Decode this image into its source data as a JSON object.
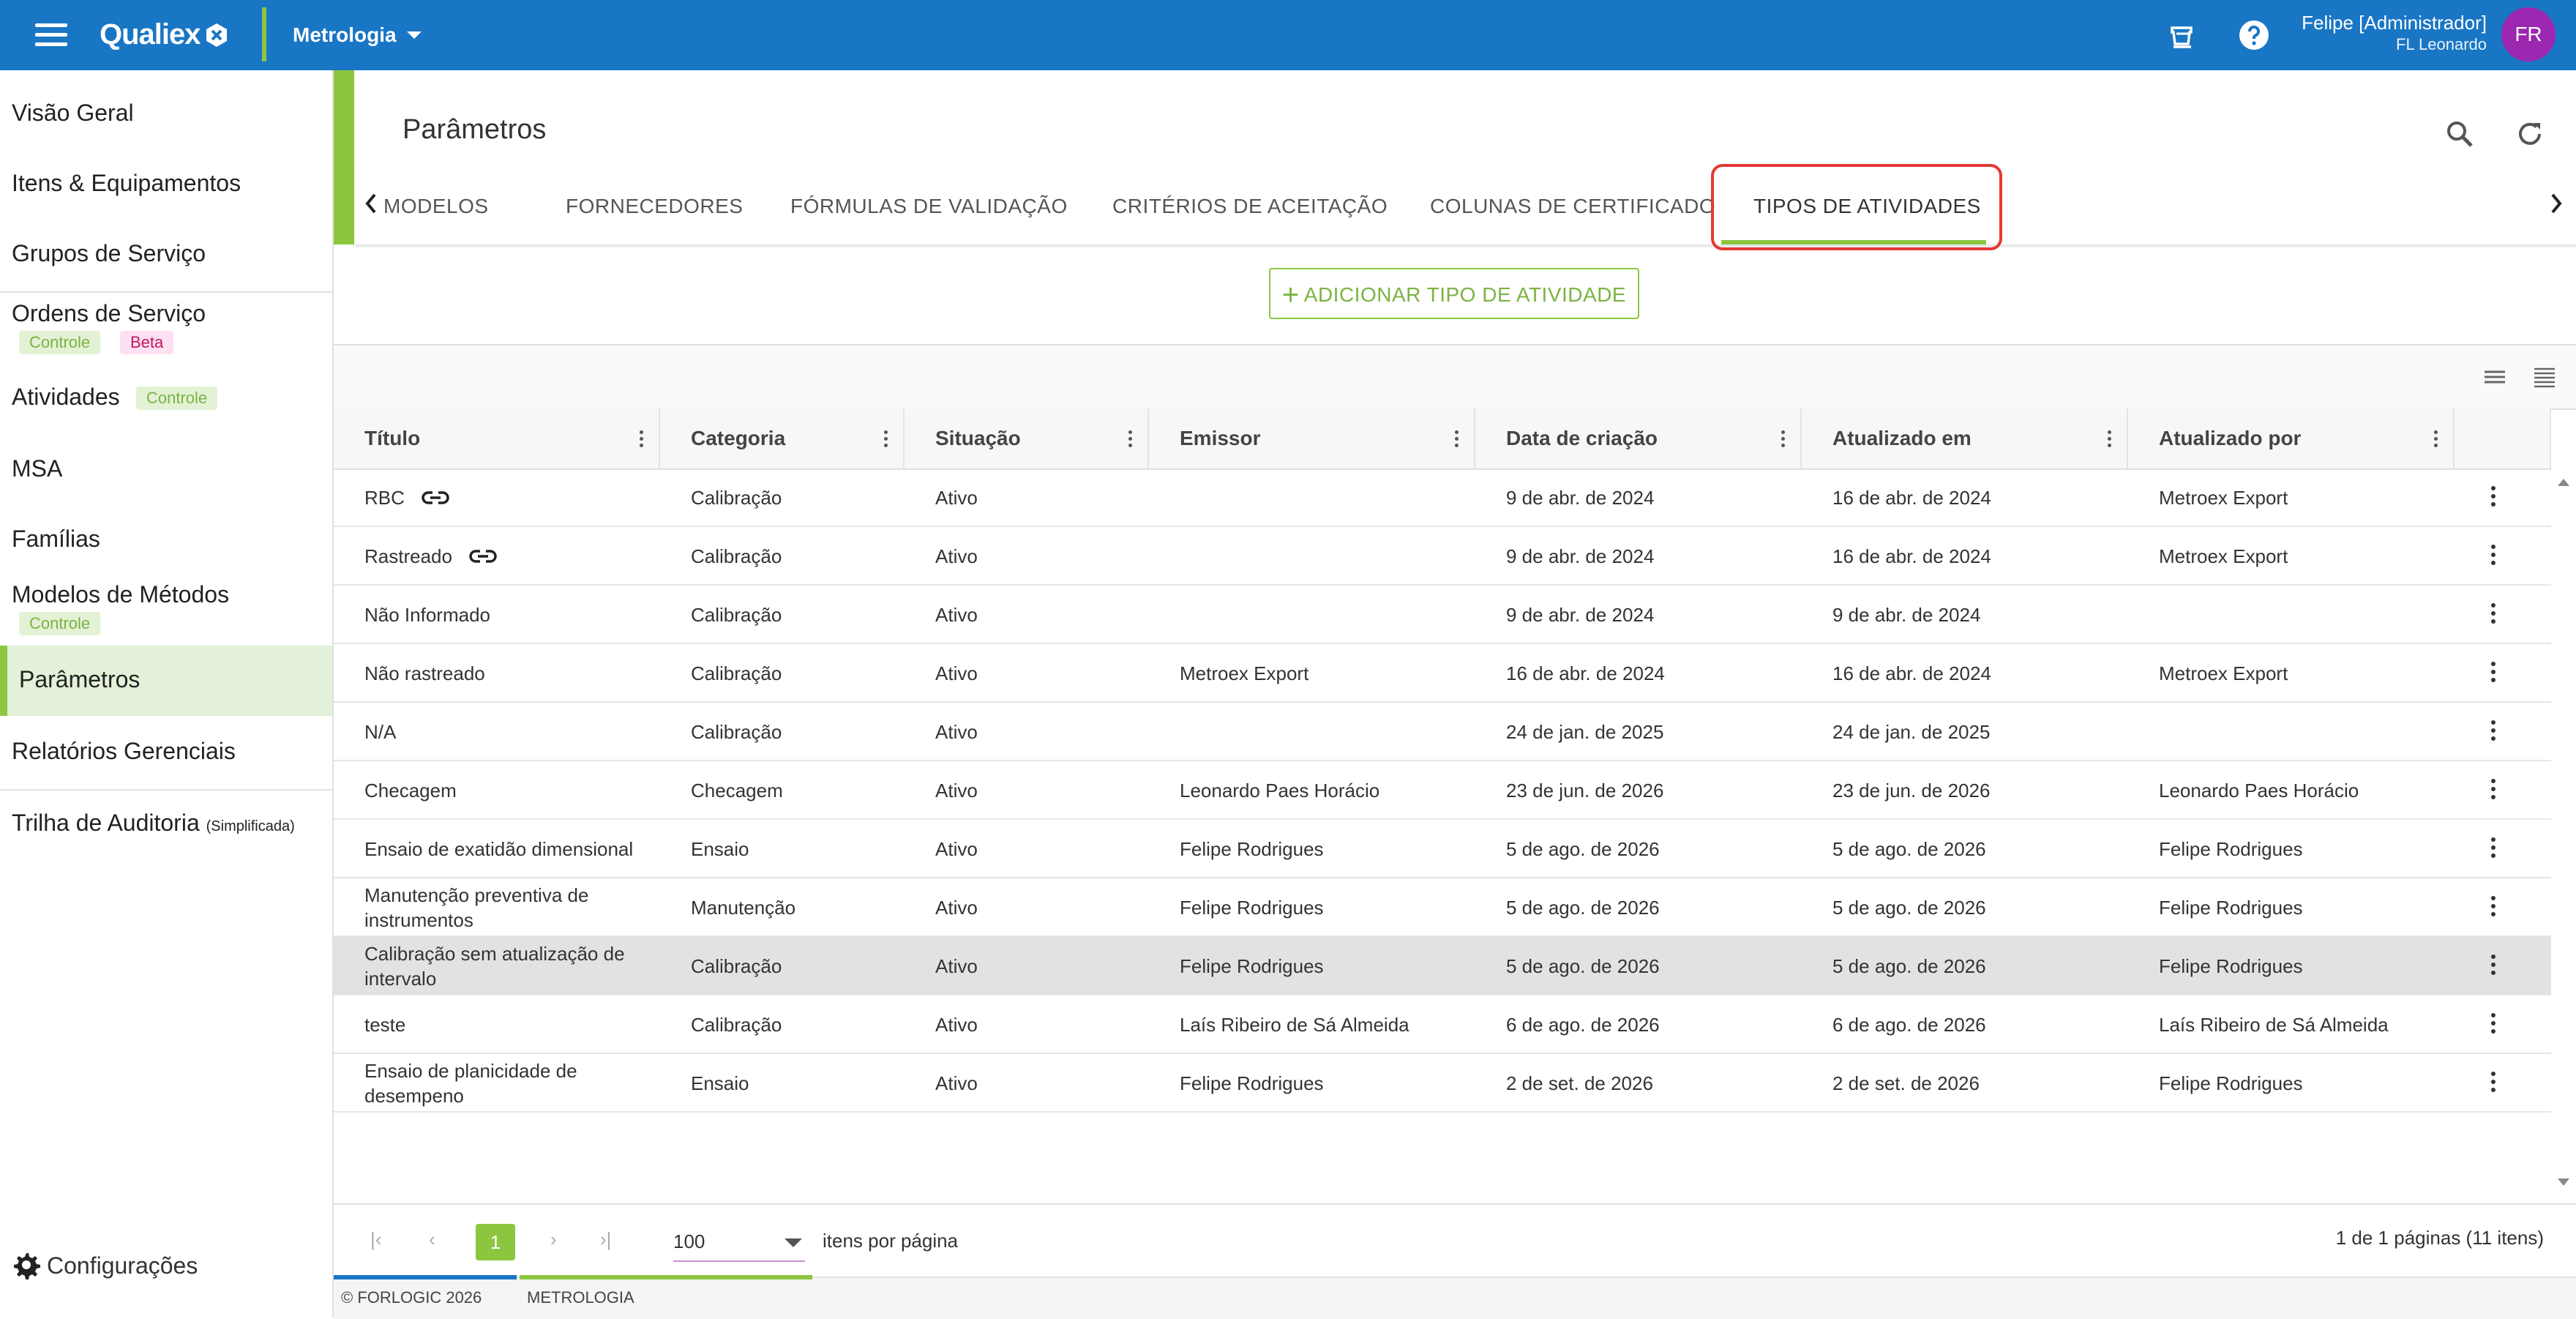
{
  "topbar": {
    "brand": "Qualiex",
    "module": "Metrologia",
    "user_name": "Felipe [Administrador]",
    "user_sub": "FL Leonardo",
    "avatar": "FR",
    "icons": [
      "menu-icon",
      "coffee-cup-icon",
      "help-icon"
    ]
  },
  "sidebar": {
    "items": [
      {
        "label": "Visão Geral"
      },
      {
        "label": "Itens & Equipamentos"
      },
      {
        "label": "Grupos de Serviço"
      },
      {
        "label": "Ordens de Serviço",
        "badges": [
          "Controle",
          "Beta"
        ]
      },
      {
        "label": "Atividades",
        "badges": [
          "Controle"
        ]
      },
      {
        "label": "MSA"
      },
      {
        "label": "Famílias"
      },
      {
        "label": "Modelos de Métodos",
        "badges": [
          "Controle"
        ]
      },
      {
        "label": "Parâmetros"
      },
      {
        "label": "Relatórios Gerenciais"
      },
      {
        "label": "Trilha de Auditoria",
        "suffix": "(Simplificada)"
      }
    ],
    "config_label": "Configurações"
  },
  "page": {
    "title": "Parâmetros",
    "tabs": [
      "MODELOS",
      "FORNECEDORES",
      "FÓRMULAS DE VALIDAÇÃO",
      "CRITÉRIOS DE ACEITAÇÃO",
      "COLUNAS DE CERTIFICADO",
      "TIPOS DE ATIVIDADES"
    ],
    "active_tab": "TIPOS DE ATIVIDADES",
    "add_button": "ADICIONAR TIPO DE ATIVIDADE"
  },
  "table": {
    "columns": [
      "Título",
      "Categoria",
      "Situação",
      "Emissor",
      "Data de criação",
      "Atualizado em",
      "Atualizado por"
    ],
    "rows": [
      {
        "titulo": "RBC",
        "link": true,
        "categoria": "Calibração",
        "situacao": "Ativo",
        "emissor": "",
        "criacao": "9 de abr. de 2024",
        "atualizado": "16 de abr. de 2024",
        "por": "Metroex Export"
      },
      {
        "titulo": "Rastreado",
        "link": true,
        "categoria": "Calibração",
        "situacao": "Ativo",
        "emissor": "",
        "criacao": "9 de abr. de 2024",
        "atualizado": "16 de abr. de 2024",
        "por": "Metroex Export"
      },
      {
        "titulo": "Não Informado",
        "categoria": "Calibração",
        "situacao": "Ativo",
        "emissor": "",
        "criacao": "9 de abr. de 2024",
        "atualizado": "9 de abr. de 2024",
        "por": ""
      },
      {
        "titulo": "Não rastreado",
        "categoria": "Calibração",
        "situacao": "Ativo",
        "emissor": "Metroex Export",
        "criacao": "16 de abr. de 2024",
        "atualizado": "16 de abr. de 2024",
        "por": "Metroex Export"
      },
      {
        "titulo": "N/A",
        "categoria": "Calibração",
        "situacao": "Ativo",
        "emissor": "",
        "criacao": "24 de jan. de 2025",
        "atualizado": "24 de jan. de 2025",
        "por": ""
      },
      {
        "titulo": "Checagem",
        "categoria": "Checagem",
        "situacao": "Ativo",
        "emissor": "Leonardo Paes Horácio",
        "criacao": "23 de jun. de 2026",
        "atualizado": "23 de jun. de 2026",
        "por": "Leonardo Paes Horácio"
      },
      {
        "titulo": "Ensaio de exatidão dimensional",
        "categoria": "Ensaio",
        "situacao": "Ativo",
        "emissor": "Felipe Rodrigues",
        "criacao": "5 de ago. de 2026",
        "atualizado": "5 de ago. de 2026",
        "por": "Felipe Rodrigues"
      },
      {
        "titulo": "Manutenção preventiva de instrumentos",
        "categoria": "Manutenção",
        "situacao": "Ativo",
        "emissor": "Felipe Rodrigues",
        "criacao": "5 de ago. de 2026",
        "atualizado": "5 de ago. de 2026",
        "por": "Felipe Rodrigues"
      },
      {
        "titulo": "Calibração sem atualização de intervalo",
        "categoria": "Calibração",
        "situacao": "Ativo",
        "emissor": "Felipe Rodrigues",
        "criacao": "5 de ago. de 2026",
        "atualizado": "5 de ago. de 2026",
        "por": "Felipe Rodrigues",
        "selected": true
      },
      {
        "titulo": "teste",
        "categoria": "Calibração",
        "situacao": "Ativo",
        "emissor": "Laís Ribeiro de Sá Almeida",
        "criacao": "6 de ago. de 2026",
        "atualizado": "6 de ago. de 2026",
        "por": "Laís Ribeiro de Sá Almeida"
      },
      {
        "titulo": "Ensaio de planicidade de desempeno",
        "categoria": "Ensaio",
        "situacao": "Ativo",
        "emissor": "Felipe Rodrigues",
        "criacao": "2 de set. de 2026",
        "atualizado": "2 de set. de 2026",
        "por": "Felipe Rodrigues"
      }
    ]
  },
  "pager": {
    "current_page": "1",
    "page_size": "100",
    "page_size_label": "itens por página",
    "info": "1 de 1 páginas (11 itens)"
  },
  "footer": {
    "copyright": "© FORLOGIC 2026",
    "module": "METROLOGIA"
  },
  "colors": {
    "topbar": "#1976c4",
    "accent_green": "#8cc63f",
    "avatar": "#9c27b0",
    "highlight": "#e53935"
  }
}
